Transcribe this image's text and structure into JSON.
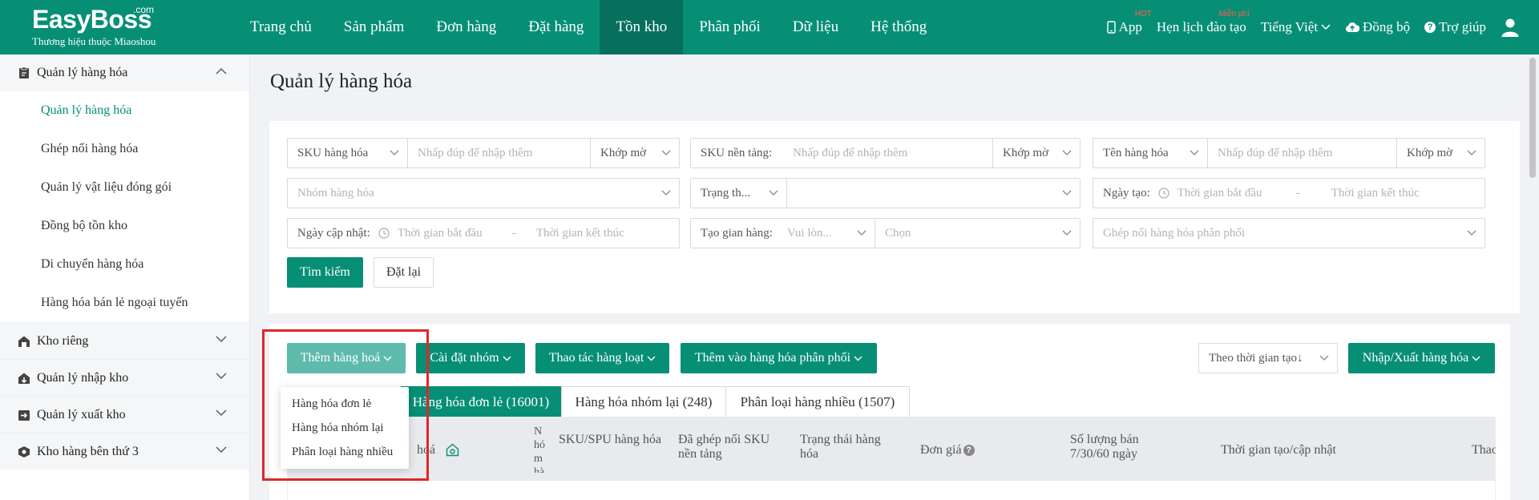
{
  "brand": {
    "name": "EasyBoss",
    "com": ".com",
    "tagline": "Thương hiệu thuộc Miaoshou"
  },
  "nav": {
    "items": [
      "Trang chủ",
      "Sản phẩm",
      "Đơn hàng",
      "Đặt hàng",
      "Tồn kho",
      "Phân phối",
      "Dữ liệu",
      "Hệ thống"
    ],
    "active": "Tồn kho"
  },
  "topright": {
    "app": "App",
    "hot": "HOT",
    "schedule": "Hẹn lịch đào tạo",
    "free": "Miễn phí",
    "language": "Tiếng Việt",
    "sync": "Đồng bộ",
    "help": "Trợ giúp"
  },
  "sidebar": {
    "groups": [
      {
        "label": "Quản lý hàng hóa",
        "icon": "clipboard-icon",
        "open": true,
        "items": [
          "Quản lý hàng hóa",
          "Ghép nối hàng hóa",
          "Quản lý vật liệu đóng gói",
          "Đồng bộ tồn kho",
          "Di chuyển hàng hóa",
          "Hàng hóa bán lẻ ngoại tuyến"
        ]
      },
      {
        "label": "Kho riêng",
        "icon": "warehouse-icon"
      },
      {
        "label": "Quản lý nhập kho",
        "icon": "inbound-icon"
      },
      {
        "label": "Quản lý xuất kho",
        "icon": "outbound-icon"
      },
      {
        "label": "Kho hàng bên thứ 3",
        "icon": "third-party-icon"
      }
    ]
  },
  "page": {
    "title": "Quản lý hàng hóa"
  },
  "filters": {
    "sku_label": "SKU hàng hóa",
    "sku_placeholder": "Nhấp đúp để nhập thêm",
    "match1": "Khớp mờ",
    "platform_sku_label": "SKU nền tảng:",
    "platform_sku_placeholder": "Nhấp đúp để nhập thêm",
    "match2": "Khớp mờ",
    "name_label": "Tên hàng hóa",
    "name_placeholder": "Nhấp đúp để nhập thêm",
    "match3": "Khớp mờ",
    "group_placeholder": "Nhóm hàng hóa",
    "status_label": "Trạng th...",
    "created_label": "Ngày tạo:",
    "start_placeholder": "Thời gian bắt đầu",
    "end_placeholder": "Thời gian kết thúc",
    "dash": "-",
    "updated_label": "Ngày cập nhật:",
    "store_label": "Tạo gian hàng:",
    "store_select": "Vui lòn...",
    "store_choose": "Chọn",
    "pairing_placeholder": "Ghép nối hàng hóa phân phối",
    "search_btn": "Tìm kiếm",
    "reset_btn": "Đặt lại"
  },
  "actions": {
    "add": "Thêm hàng hoá",
    "group_setting": "Cài đặt nhóm",
    "batch": "Thao tác hàng loạt",
    "add_distribution": "Thêm vào hàng hóa phân phối",
    "sort": "Theo thời gian tạo↓",
    "import_export": "Nhập/Xuất hàng hóa"
  },
  "tabs": [
    "Hàng hóa đơn lẻ (16001)",
    "Hàng hóa nhóm lại (248)",
    "Phân loại hàng nhiều (1507)"
  ],
  "table_headers": {
    "product": "hoá",
    "group_short": "Nhóm hàng hóa",
    "sku_spu": "SKU/SPU hàng hóa",
    "paired_sku": "Đã ghép nối SKU nền tảng",
    "status": "Trạng thái hàng hóa",
    "price": "Đơn giá",
    "sales": "Số lượng bán 7/30/60 ngày",
    "time": "Thời gian tạo/cập nhật",
    "ops": "Thao"
  },
  "dropdown": [
    "Hàng hóa đơn lẻ",
    "Hàng hóa nhóm lại",
    "Phân loại hàng nhiều"
  ],
  "colors": {
    "primary": "#078f76",
    "highlight": "#e0262b"
  }
}
